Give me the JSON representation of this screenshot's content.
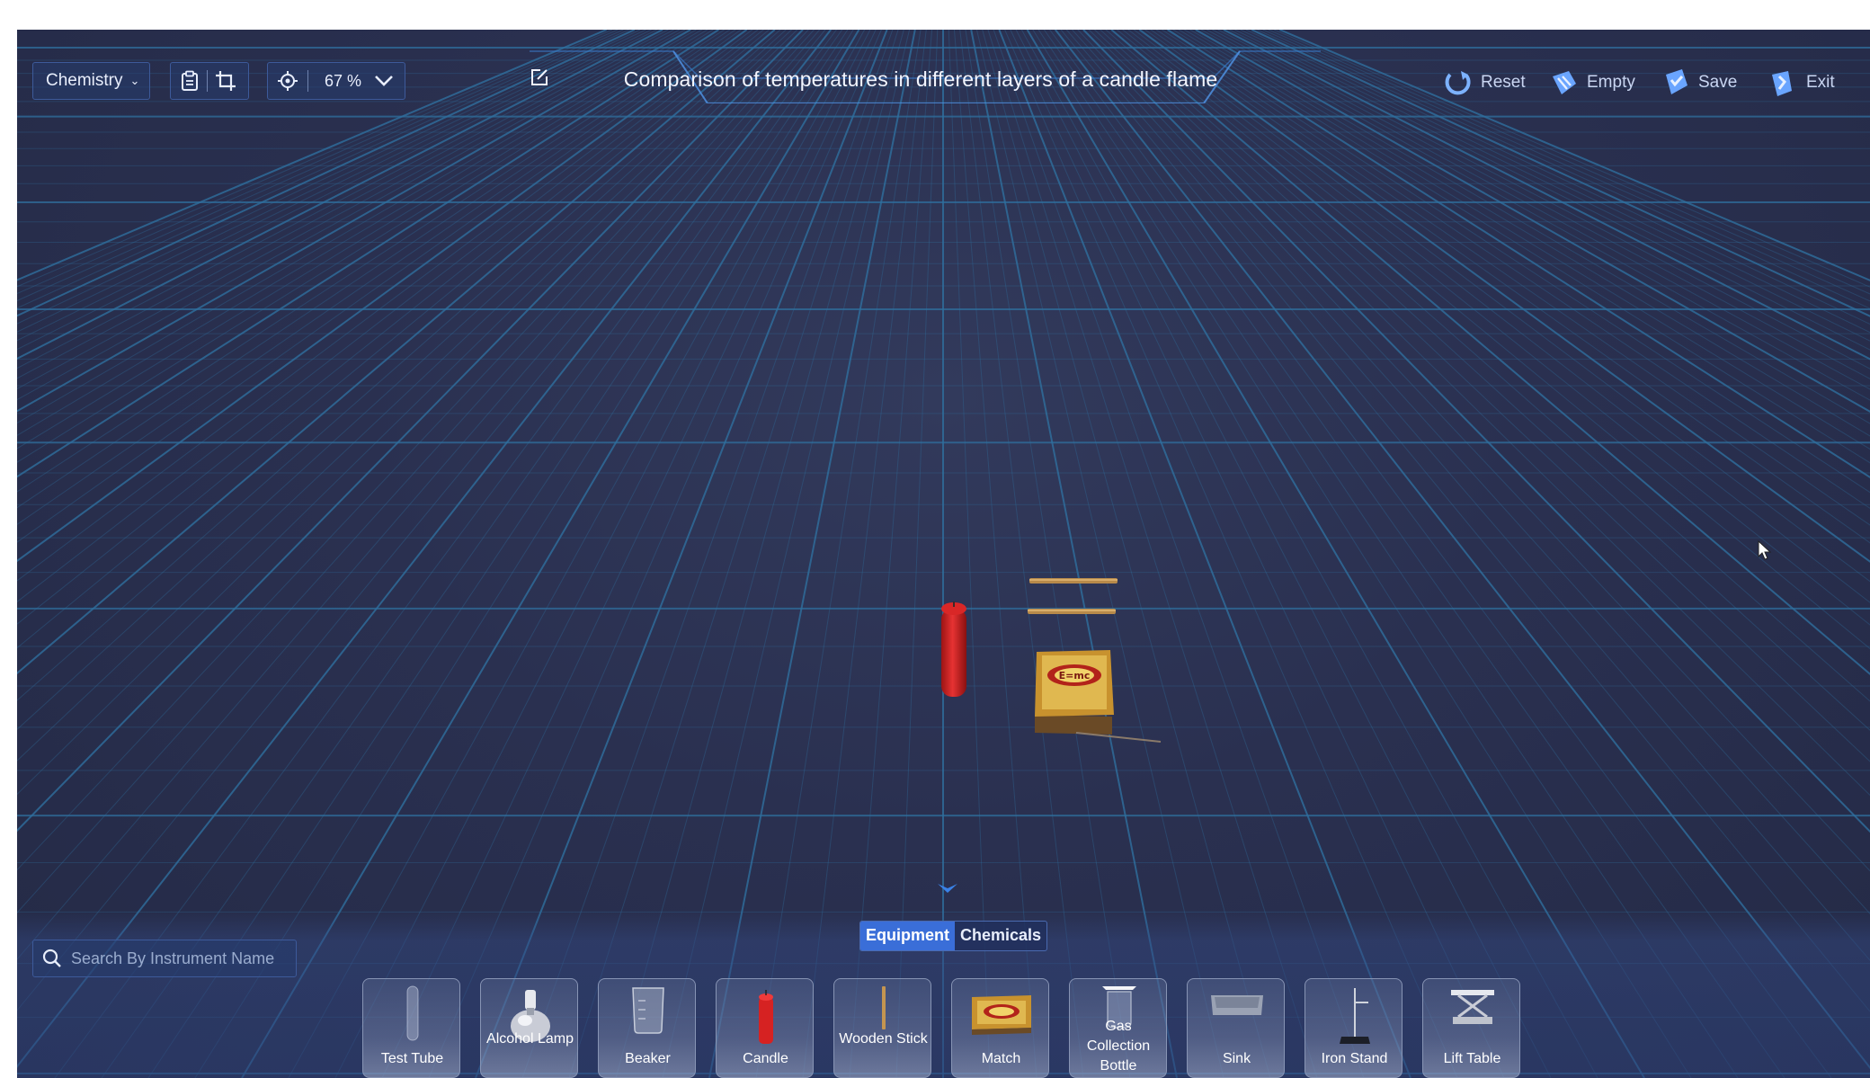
{
  "header": {
    "subject": "Chemistry",
    "zoom": "67 %",
    "title": "Comparison of temperatures in different layers of a candle flame",
    "actions": {
      "reset": "Reset",
      "empty": "Empty",
      "save": "Save",
      "exit": "Exit"
    }
  },
  "scene": {
    "objects": [
      "candle",
      "wooden-sticks",
      "matchbox"
    ]
  },
  "panel": {
    "tabs": [
      {
        "label": "Equipment",
        "active": true
      },
      {
        "label": "Chemicals",
        "active": false
      }
    ],
    "search": {
      "placeholder": "Search By Instrument Name",
      "value": ""
    },
    "items": [
      {
        "label": "Test Tube"
      },
      {
        "label": "Alcohol Lamp"
      },
      {
        "label": "Beaker"
      },
      {
        "label": "Candle"
      },
      {
        "label": "Wooden Stick"
      },
      {
        "label": "Match"
      },
      {
        "label": "Gas Collection Bottle"
      },
      {
        "label": "Sink"
      },
      {
        "label": "Iron Stand"
      },
      {
        "label": "Lift Table"
      }
    ]
  },
  "colors": {
    "background": "#2a3050",
    "grid": "#2f6f9e",
    "accent": "#3a6ed8",
    "candle": "#d22a2a"
  }
}
